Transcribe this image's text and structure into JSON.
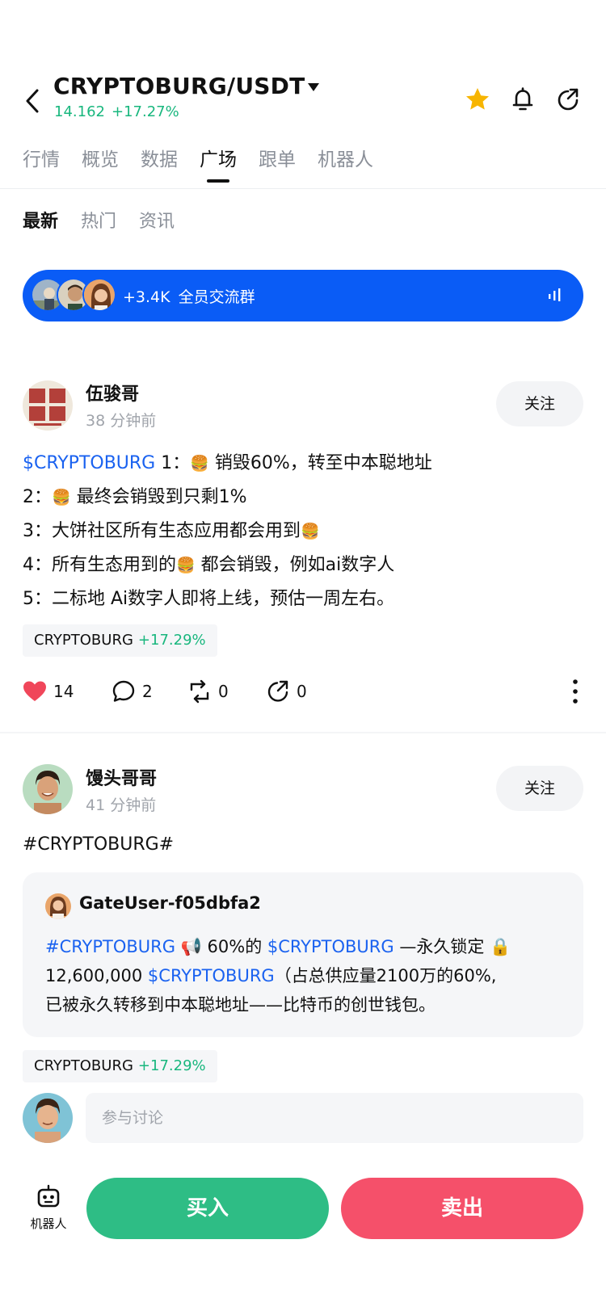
{
  "header": {
    "pair": "CRYPTOBURG/USDT",
    "price": "14.162",
    "change": "+17.27%",
    "colors": {
      "up": "#19b77e",
      "star": "#f7b500"
    },
    "icons": [
      "back-icon",
      "dropdown-icon",
      "star-icon",
      "bell-icon",
      "share-icon"
    ]
  },
  "main_tabs": [
    "行情",
    "概览",
    "数据",
    "广场",
    "跟单",
    "机器人"
  ],
  "main_tabs_active": "广场",
  "sub_tabs": [
    "最新",
    "热门",
    "资讯"
  ],
  "sub_tabs_active": "最新",
  "group_banner": {
    "count": "+3.4K",
    "label": "全员交流群",
    "color": "#0a5cf6"
  },
  "posts": [
    {
      "author": "伍骏哥",
      "time": "38 分钟前",
      "follow_label": "关注",
      "lines": [
        {
          "link": "$CRYPTOBURG",
          "text_a": " 1：",
          "text_b": " 销毁60%，转至中本聪地址"
        },
        {
          "text_a": "2：",
          "text_b": " 最终会销毁到只剩1%"
        },
        {
          "text_a": "3：大饼社区所有生态应用都会用到"
        },
        {
          "text_a": "4：所有生态用到的",
          "text_b": " 都会销毁，例如ai数字人"
        },
        {
          "text_a": "5：二标地 Ai数字人即将上线，预估一周左右。"
        }
      ],
      "tag": {
        "symbol": "CRYPTOBURG",
        "change": "+17.29%"
      },
      "likes": "14",
      "comments": "2",
      "reposts": "0",
      "shares": "0"
    },
    {
      "author": "馒头哥哥",
      "time": "41 分钟前",
      "follow_label": "关注",
      "hashtag": "#CRYPTOBURG#",
      "quote": {
        "user": "GateUser-f05dbfa2",
        "hashtag": "#CRYPTOBURG",
        "text_1": " 60%的 ",
        "link_1": "$CRYPTOBURG",
        "text_2": " —永久锁定",
        "amount": "12,600,000 ",
        "link_2": "$CRYPTOBURG",
        "text_3": "（占总供应量2100万的60%,",
        "text_4": "已被永久转移到中本聪地址——比特币的创世钱包。"
      },
      "tag": {
        "symbol": "CRYPTOBURG",
        "change": "+17.29%"
      }
    }
  ],
  "comment": {
    "placeholder": "参与讨论"
  },
  "bottom_bar": {
    "robot_label": "机器人",
    "buy_label": "买入",
    "sell_label": "卖出",
    "colors": {
      "buy": "#2ebd85",
      "sell": "#f5506a"
    }
  }
}
